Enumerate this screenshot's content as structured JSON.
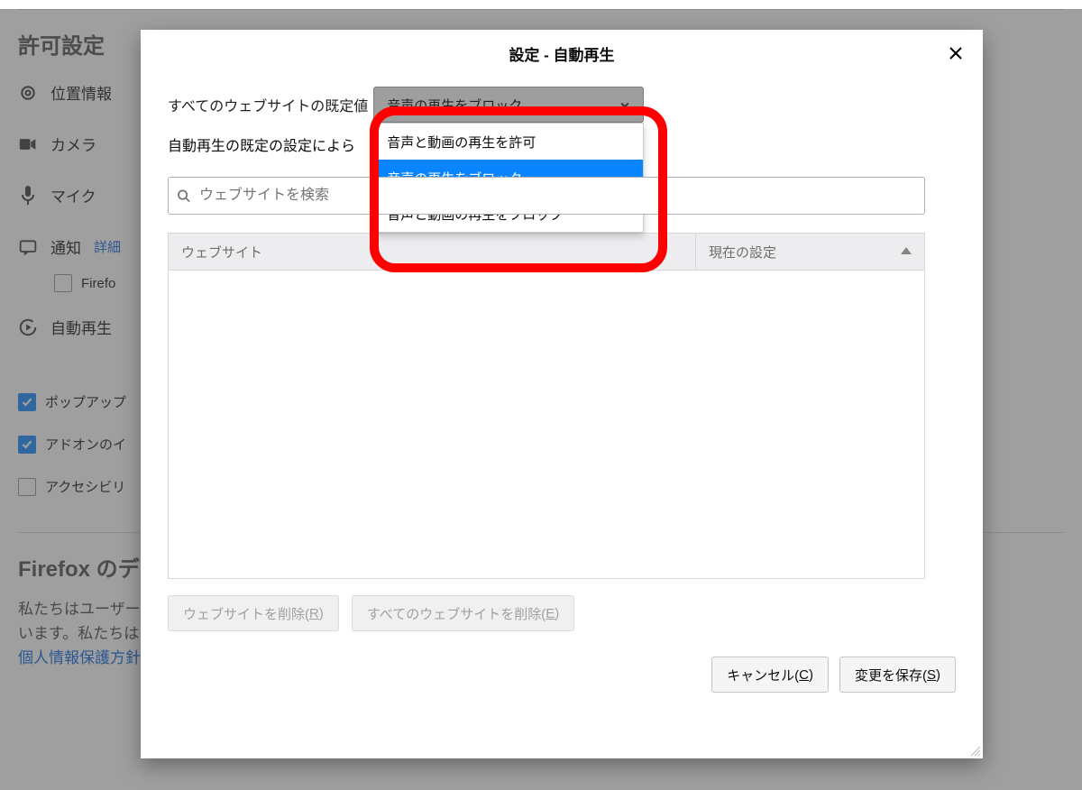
{
  "permissions": {
    "section_title": "許可設定",
    "location": "位置情報",
    "camera": "カメラ",
    "microphone": "マイク",
    "notifications": "通知",
    "notifications_more": "詳細",
    "firefox_sub": "Firefo",
    "autoplay": "自動再生",
    "popup_checkbox": "ポップアップ",
    "addon_checkbox": "アドオンのイ",
    "accessibility_checkbox": "アクセシビリ"
  },
  "data_section": {
    "title": "Firefox のデ",
    "para1": "私たちはユーザー",
    "para2": "います。私たちは",
    "link": "個人情報保護方針"
  },
  "dialog": {
    "title": "設定 - 自動再生",
    "default_label": "すべてのウェブサイトの既定値",
    "dropdown_selected": "音声の再生をブロック",
    "options": {
      "0": "音声と動画の再生を許可",
      "1": "音声の再生をブロック",
      "2": "音声と動画の再生をブロック"
    },
    "desc": "自動再生の既定の設定によら",
    "search_placeholder": "ウェブサイトを検索",
    "col_site": "ウェブサイト",
    "col_status": "現在の設定",
    "btn_remove_site_pre": "ウェブサイトを削除(",
    "btn_remove_site_key": "R",
    "btn_remove_site_post": ")",
    "btn_remove_all_pre": "すべてのウェブサイトを削除(",
    "btn_remove_all_key": "E",
    "btn_remove_all_post": ")",
    "btn_cancel_pre": "キャンセル(",
    "btn_cancel_key": "C",
    "btn_cancel_post": ")",
    "btn_save_pre": "変更を保存(",
    "btn_save_key": "S",
    "btn_save_post": ")"
  }
}
